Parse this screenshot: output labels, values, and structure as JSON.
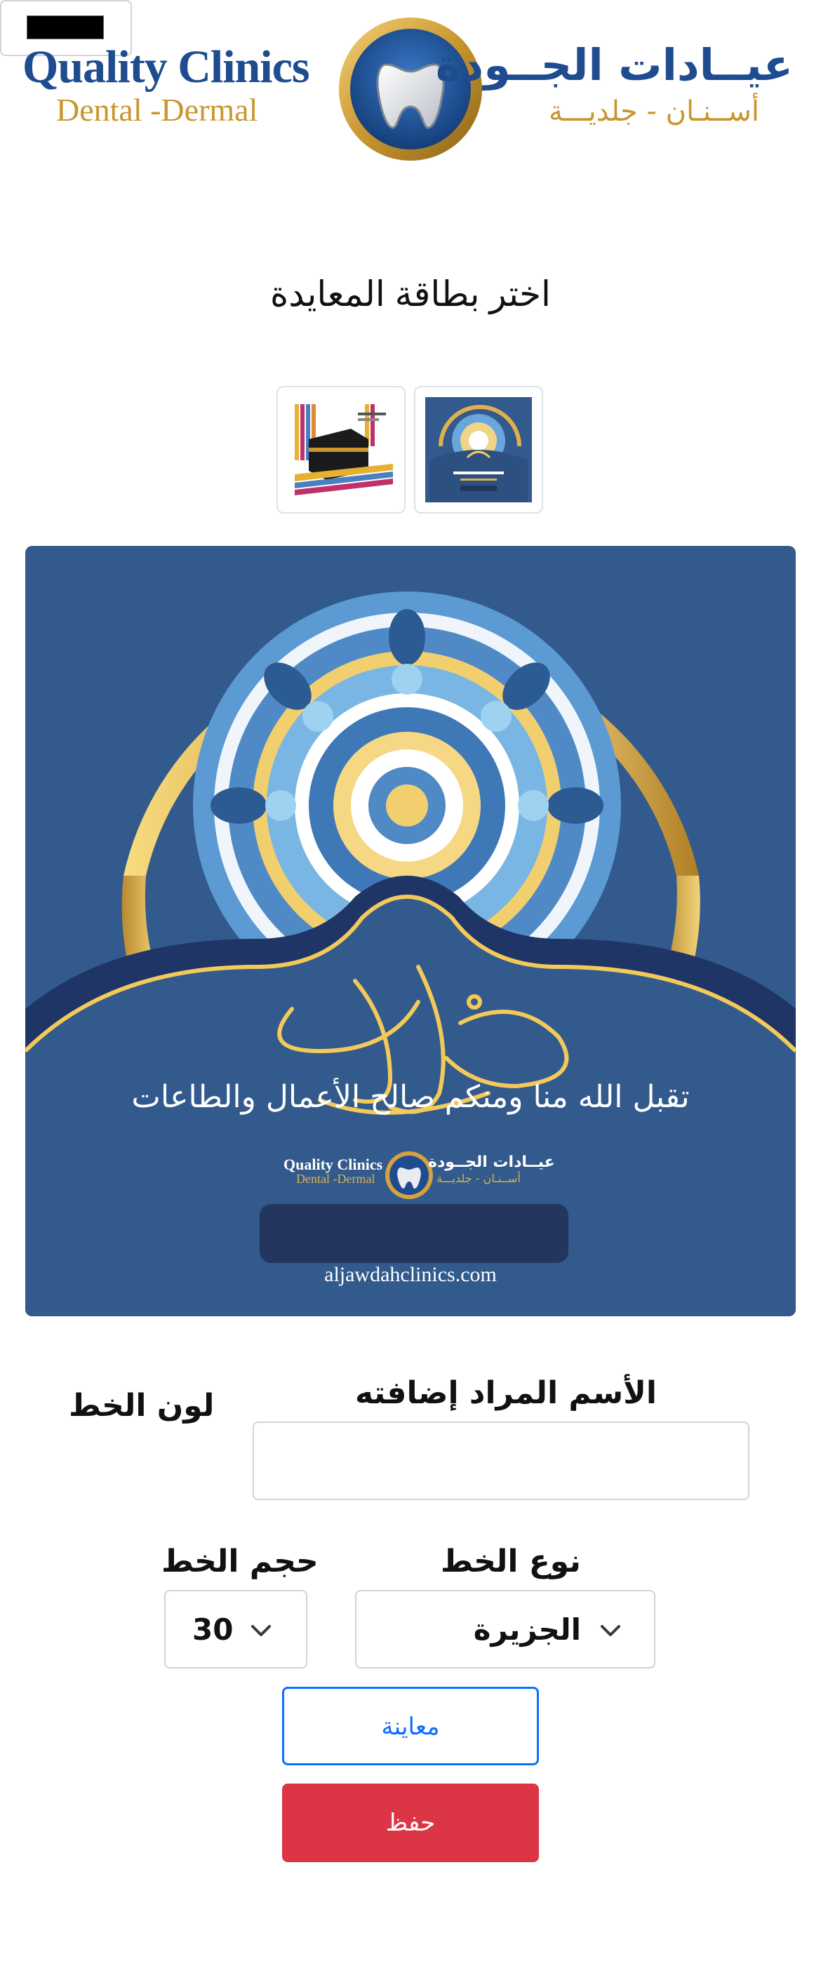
{
  "header": {
    "logo_en_line1": "Quality Clinics",
    "logo_en_line2": "Dental -Dermal",
    "logo_ar_line1": "عيــادات الجــودة",
    "logo_ar_line2": "أســنـان - جلديـــة",
    "logo_icon": "tooth-logo-icon"
  },
  "page_title": "اختر بطاقة المعايدة",
  "thumbnails": [
    {
      "name": "hajj-kaaba-card",
      "selected": false
    },
    {
      "name": "eid-blue-mandala-card",
      "selected": true
    }
  ],
  "card_preview": {
    "greeting_text": "تقبل الله منا ومنكم صالح الأعمال والطاعات",
    "logo_en_line1": "Quality Clinics",
    "logo_en_line2": "Dental -Dermal",
    "logo_ar_line1": "عيــادات الجــودة",
    "logo_ar_line2": "أســنـان - جلديـــة",
    "url": "aljawdahclinics.com"
  },
  "form": {
    "name_label": "الأسم المراد إضافته",
    "name_value": "",
    "color_label": "لون الخط",
    "color_value": "#000000",
    "font_label": "نوع الخط",
    "font_value": "الجزيرة",
    "size_label": "حجم الخط",
    "size_value": "30",
    "preview_button": "معاينة",
    "save_button": "حفظ"
  },
  "colors": {
    "brand_blue": "#1e4c8f",
    "brand_gold": "#c9962f",
    "card_bg": "#325a8c",
    "primary": "#0d6efd",
    "danger": "#dc3545"
  }
}
